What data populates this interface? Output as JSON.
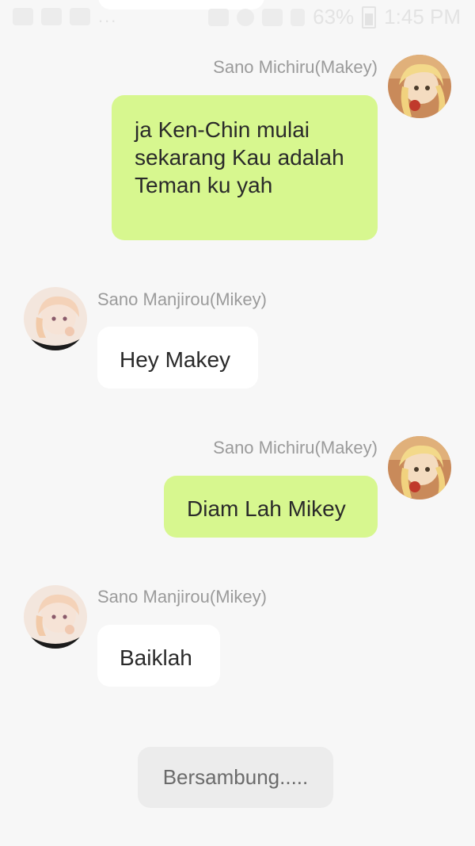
{
  "status_bar": {
    "dots": "...",
    "battery": "63%",
    "time": "1:45 PM"
  },
  "messages": [
    {
      "sender": "Sano Michiru(Makey)",
      "side": "right",
      "text": "ja Ken-Chin mulai sekarang Kau adalah Teman ku yah"
    },
    {
      "sender": "Sano Manjirou(Mikey)",
      "side": "left",
      "text": "Hey Makey"
    },
    {
      "sender": "Sano Michiru(Makey)",
      "side": "right",
      "text": "Diam Lah Mikey"
    },
    {
      "sender": "Sano Manjirou(Mikey)",
      "side": "left",
      "text": "Baiklah"
    }
  ],
  "footer": {
    "continue_label": "Bersambung....."
  },
  "colors": {
    "background": "#f7f7f7",
    "bubble_right": "#d7f78f",
    "bubble_left": "#ffffff",
    "name_text": "#9b9b9b",
    "continue_bg": "#ececec"
  },
  "icons": [
    "image-icon",
    "missed-call-icon",
    "message-icon",
    "cast-icon",
    "alarm-icon",
    "wifi-icon",
    "signal-icon",
    "battery-icon"
  ]
}
